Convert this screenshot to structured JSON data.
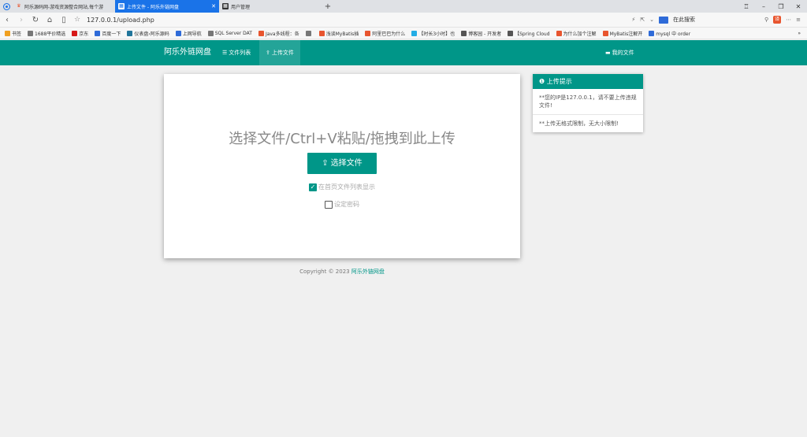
{
  "browser": {
    "tabs": [
      {
        "title": "阿乐源码网-游戏资源整合网站,每个游"
      },
      {
        "title": "上传文件 - 阿乐外链网盘",
        "active": true
      },
      {
        "title": "用户管理"
      }
    ],
    "url": "127.0.0.1/upload.php",
    "search_placeholder": "在此搜索",
    "bookmarks": [
      {
        "label": "书签",
        "color": "#f0a020"
      },
      {
        "label": "1688平价精选",
        "color": "#777"
      },
      {
        "label": "京东",
        "color": "#d71a1a"
      },
      {
        "label": "百度一下",
        "color": "#2f6bd8"
      },
      {
        "label": "仪表盘‹阿乐源码",
        "color": "#21759b"
      },
      {
        "label": "上网导航",
        "color": "#2f6bd8"
      },
      {
        "label": "SQL Server DAT",
        "color": "#777"
      },
      {
        "label": "Java多线程：各",
        "color": "#e8552f"
      },
      {
        "label": "",
        "color": "#777"
      },
      {
        "label": "浅谈MyBatis插",
        "color": "#e8552f"
      },
      {
        "label": "阿里巴巴为什么",
        "color": "#e8552f"
      },
      {
        "label": "【时长3小时】也",
        "color": "#23ade5"
      },
      {
        "label": "博客园 - 开发者",
        "color": "#555"
      },
      {
        "label": "【Spring Cloud",
        "color": "#555"
      },
      {
        "label": "为什么加个注解",
        "color": "#e8552f"
      },
      {
        "label": "MyBatis注解开",
        "color": "#e8552f"
      },
      {
        "label": "mysql 中 order",
        "color": "#2f6bd8"
      }
    ]
  },
  "site": {
    "brand": "阿乐外链网盘",
    "nav": {
      "file_list": "文件列表",
      "upload": "上传文件",
      "my_files": "我的文件"
    },
    "colors": {
      "primary": "#009688"
    }
  },
  "upload": {
    "drop_text": "选择文件/Ctrl+V粘贴/拖拽到此上传",
    "button_label": "选择文件",
    "show_on_home_label": "在首页文件列表显示",
    "show_on_home_checked": true,
    "set_password_label": "设定密码",
    "set_password_checked": false
  },
  "tips": {
    "title": "上传提示",
    "items": [
      "**您的IP是127.0.0.1，请不要上传违规文件!",
      "**上传无格式限制，无大小限制!"
    ]
  },
  "footer": {
    "copyright": "Copyright © 2023",
    "link": "阿乐外链网盘"
  }
}
